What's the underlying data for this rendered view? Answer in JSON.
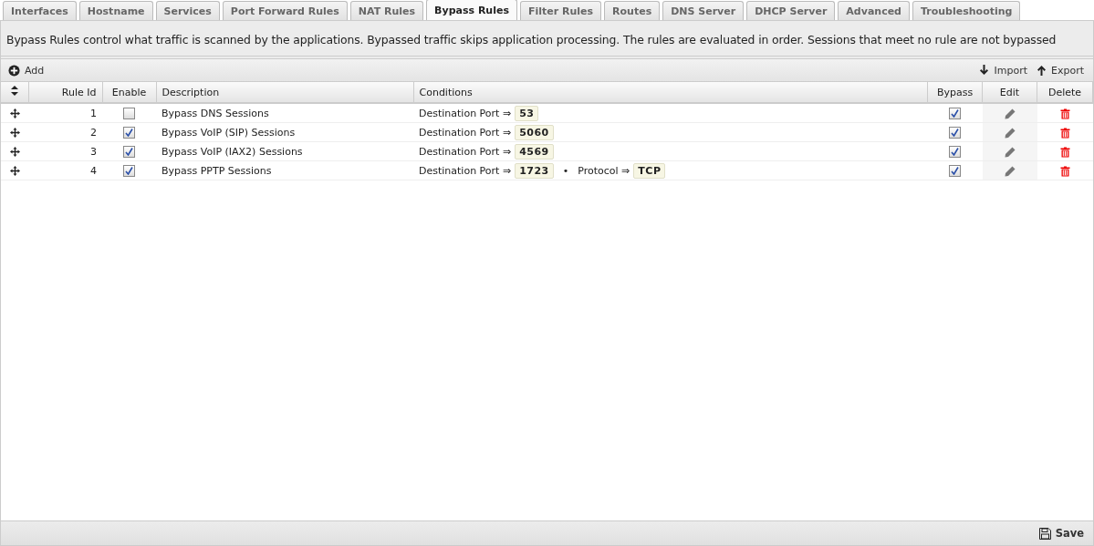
{
  "tabs": [
    {
      "label": "Interfaces",
      "selected": false
    },
    {
      "label": "Hostname",
      "selected": false
    },
    {
      "label": "Services",
      "selected": false
    },
    {
      "label": "Port Forward Rules",
      "selected": false
    },
    {
      "label": "NAT Rules",
      "selected": false
    },
    {
      "label": "Bypass Rules",
      "selected": true
    },
    {
      "label": "Filter Rules",
      "selected": false
    },
    {
      "label": "Routes",
      "selected": false
    },
    {
      "label": "DNS Server",
      "selected": false
    },
    {
      "label": "DHCP Server",
      "selected": false
    },
    {
      "label": "Advanced",
      "selected": false
    },
    {
      "label": "Troubleshooting",
      "selected": false
    }
  ],
  "description": "Bypass Rules control what traffic is scanned by the applications. Bypassed traffic skips application processing. The rules are evaluated in order. Sessions that meet no rule are not bypassed",
  "toolbar": {
    "add": "Add",
    "import": "Import",
    "export": "Export"
  },
  "table": {
    "columns": [
      "Rule Id",
      "Enable",
      "Description",
      "Conditions",
      "Bypass",
      "Edit",
      "Delete"
    ],
    "rows": [
      {
        "rule_id": "1",
        "enabled": false,
        "description": "Bypass DNS Sessions",
        "conditions": [
          {
            "field": "Destination Port",
            "arrow": "⇒",
            "value": "53"
          }
        ],
        "bypass": true
      },
      {
        "rule_id": "2",
        "enabled": true,
        "description": "Bypass VoIP (SIP) Sessions",
        "conditions": [
          {
            "field": "Destination Port",
            "arrow": "⇒",
            "value": "5060"
          }
        ],
        "bypass": true
      },
      {
        "rule_id": "3",
        "enabled": true,
        "description": "Bypass VoIP (IAX2) Sessions",
        "conditions": [
          {
            "field": "Destination Port",
            "arrow": "⇒",
            "value": "4569"
          }
        ],
        "bypass": true
      },
      {
        "rule_id": "4",
        "enabled": true,
        "description": "Bypass PPTP Sessions",
        "conditions": [
          {
            "field": "Destination Port",
            "arrow": "⇒",
            "value": "1723"
          },
          {
            "separator": "•",
            "field": "Protocol",
            "arrow": "⇒",
            "value": "TCP"
          }
        ],
        "bypass": true
      }
    ]
  },
  "footer": {
    "save": "Save"
  }
}
